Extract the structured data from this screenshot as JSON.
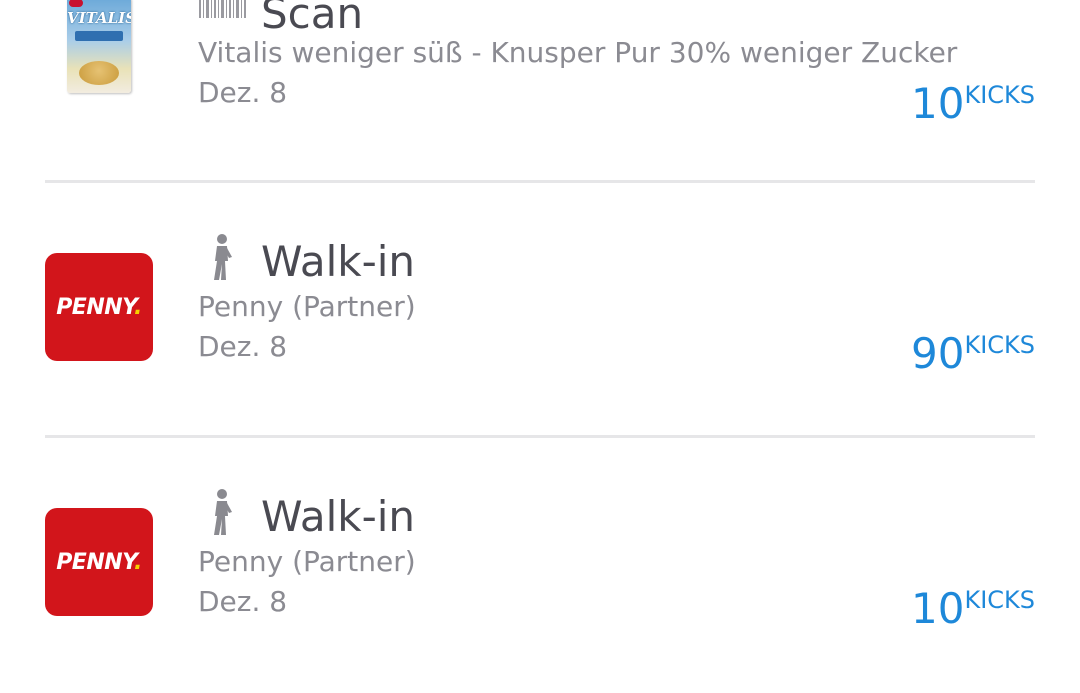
{
  "activities": [
    {
      "type_label": "Scan",
      "type_icon": "barcode-icon",
      "description": "Vitalis weniger süß - Knusper Pur 30% weniger Zucker",
      "date": "Dez. 8",
      "kicks_value": "10",
      "kicks_unit": "KICKS",
      "thumbnail": {
        "kind": "product",
        "brand_text": "VITALIS"
      }
    },
    {
      "type_label": "Walk-in",
      "type_icon": "walking-person-icon",
      "description": "Penny (Partner)",
      "date": "Dez. 8",
      "kicks_value": "90",
      "kicks_unit": "KICKS",
      "thumbnail": {
        "kind": "store-logo",
        "brand_text": "PENNY",
        "brand_dot": "."
      }
    },
    {
      "type_label": "Walk-in",
      "type_icon": "walking-person-icon",
      "description": "Penny (Partner)",
      "date": "Dez. 8",
      "kicks_value": "10",
      "kicks_unit": "KICKS",
      "thumbnail": {
        "kind": "store-logo",
        "brand_text": "PENNY",
        "brand_dot": "."
      }
    }
  ],
  "colors": {
    "accent": "#1e88d9",
    "penny_red": "#d2151b",
    "title_text": "#4a4a52",
    "secondary_text": "#8b8b92",
    "divider": "#e6e6e8"
  }
}
